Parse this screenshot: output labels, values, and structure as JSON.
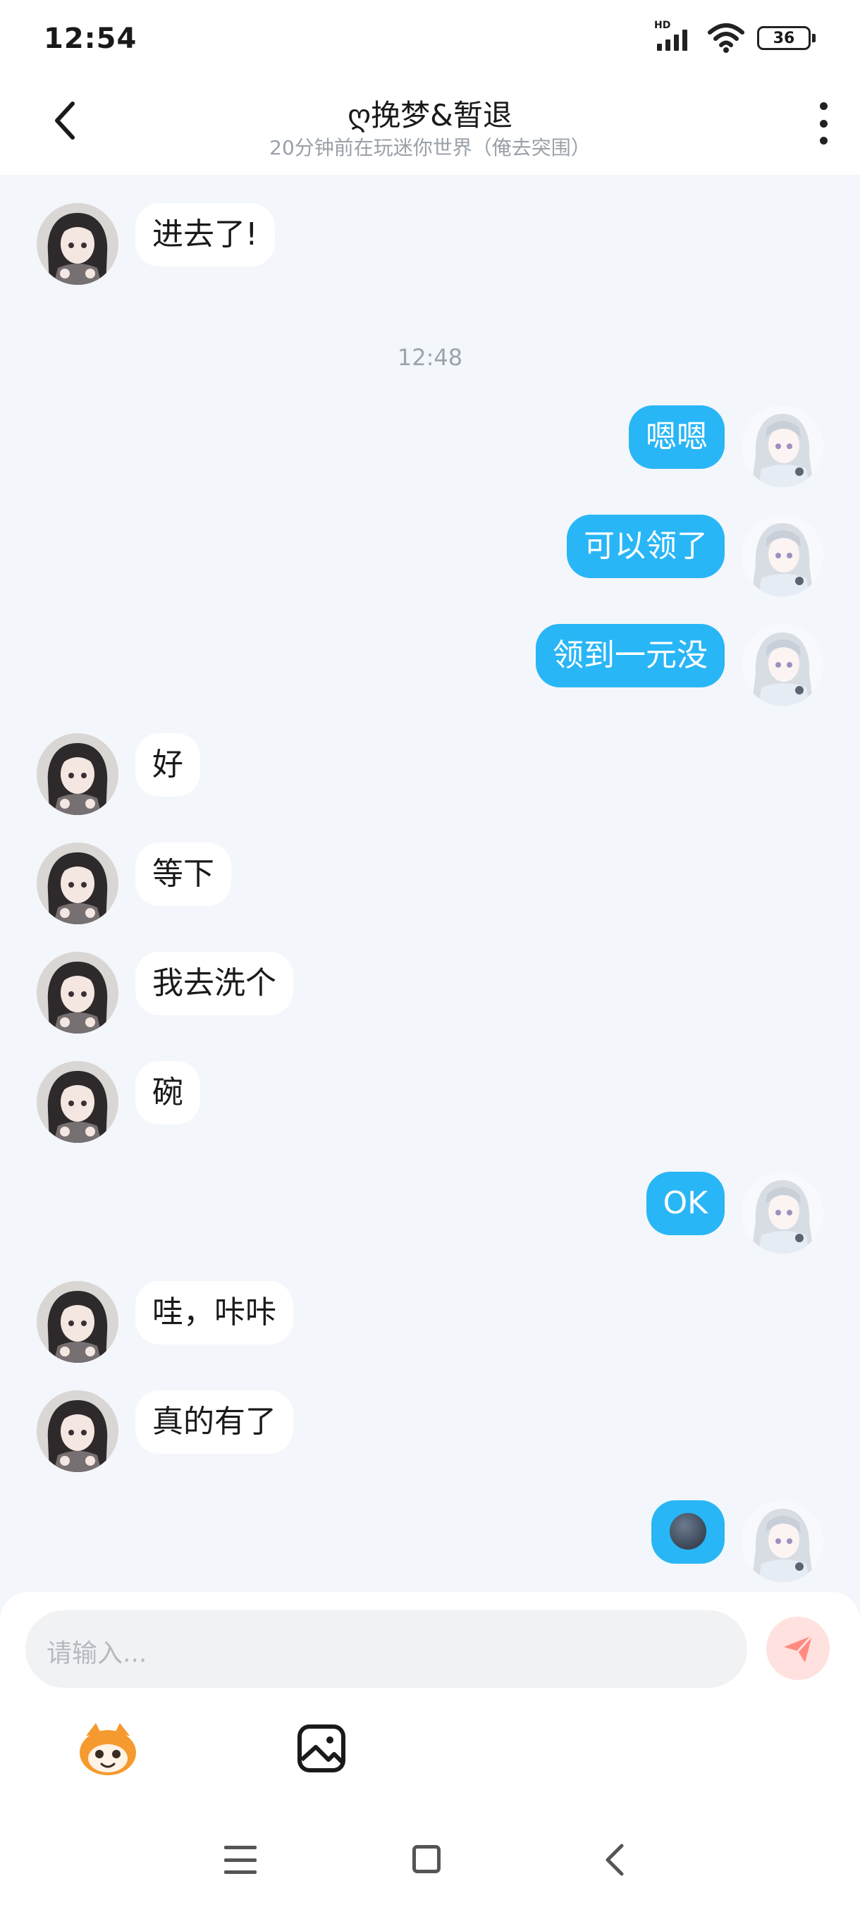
{
  "status": {
    "time": "12:54",
    "network_label": "HD",
    "battery": "36"
  },
  "header": {
    "title": "ღ挽梦&暂退",
    "subtitle": "20分钟前在玩迷你世界（俺去突围）",
    "back_icon": "chevron-left-icon",
    "more_icon": "more-vertical-icon"
  },
  "chat": {
    "timestamp": "12:48",
    "messages": [
      {
        "side": "left",
        "text": "进去了!"
      },
      {
        "side": "right",
        "text": "嗯嗯"
      },
      {
        "side": "right",
        "text": "可以领了"
      },
      {
        "side": "right",
        "text": "领到一元没"
      },
      {
        "side": "left",
        "text": "好"
      },
      {
        "side": "left",
        "text": "等下"
      },
      {
        "side": "left",
        "text": "我去洗个"
      },
      {
        "side": "left",
        "text": "碗"
      },
      {
        "side": "right",
        "text": "OK"
      },
      {
        "side": "left",
        "text": "哇，咔咔"
      },
      {
        "side": "left",
        "text": "真的有了"
      },
      {
        "side": "right",
        "text": "",
        "emoji": "new-moon-face"
      }
    ]
  },
  "input": {
    "placeholder": "请输入..."
  },
  "colors": {
    "accent": "#29B6F6",
    "background": "#F3F6FA",
    "send": "#FF8A80"
  }
}
